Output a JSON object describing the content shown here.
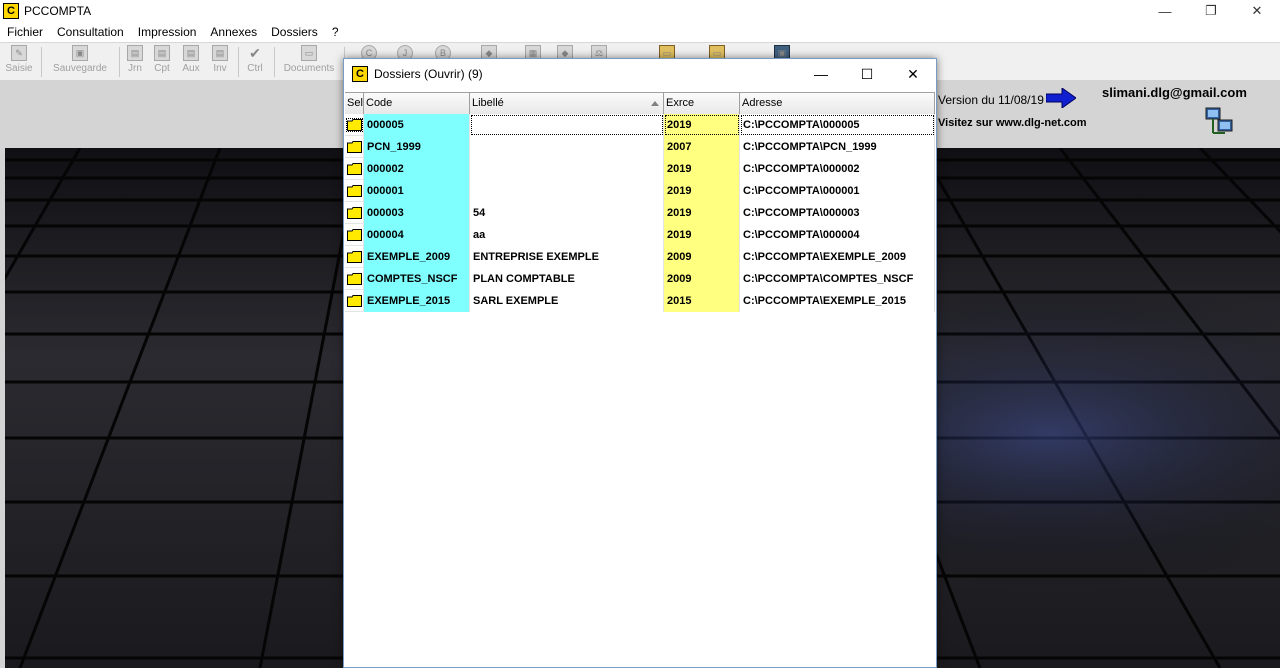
{
  "app": {
    "title": "PCCOMPTA",
    "icon_letter": "C",
    "controls": {
      "minimize": "—",
      "maximize": "❐",
      "close": "✕"
    }
  },
  "menu": [
    "Fichier",
    "Consultation",
    "Impression",
    "Annexes",
    "Dossiers",
    "?"
  ],
  "toolbar": [
    {
      "label": "Saisie",
      "icon": "pencil-icon"
    },
    {
      "label": "Sauvegarde",
      "icon": "save-icon"
    },
    {
      "label": "Jrn",
      "icon": "journal-icon"
    },
    {
      "label": "Cpt",
      "icon": "account-icon"
    },
    {
      "label": "Aux",
      "icon": "auxiliary-icon"
    },
    {
      "label": "Inv",
      "icon": "inventory-icon"
    },
    {
      "label": "Ctrl",
      "icon": "check-icon"
    },
    {
      "label": "Documents",
      "icon": "documents-icon"
    }
  ],
  "toolbar_extra_glyphs": {
    "c": "C",
    "j": "J",
    "b": "B"
  },
  "info": {
    "version": "Version du 11/08/19",
    "email": "slimani.dlg@gmail.com",
    "site": "Visitez sur  www.dlg-net.com"
  },
  "dialog": {
    "title": "Dossiers (Ouvrir)  (9)",
    "icon_letter": "C",
    "controls": {
      "minimize": "—",
      "maximize": "☐",
      "close": "✕"
    },
    "columns": {
      "sel": "Sel",
      "code": "Code",
      "libelle": "Libellé",
      "exerc": "Exrce",
      "adresse": "Adresse"
    },
    "rows": [
      {
        "code": "000005",
        "libelle": "",
        "exerc": "2019",
        "adresse": "C:\\PCCOMPTA\\000005",
        "selected": true
      },
      {
        "code": "PCN_1999",
        "libelle": "",
        "exerc": "2007",
        "adresse": "C:\\PCCOMPTA\\PCN_1999"
      },
      {
        "code": "000002",
        "libelle": "",
        "exerc": "2019",
        "adresse": "C:\\PCCOMPTA\\000002"
      },
      {
        "code": "000001",
        "libelle": "",
        "exerc": "2019",
        "adresse": "C:\\PCCOMPTA\\000001"
      },
      {
        "code": "000003",
        "libelle": "54",
        "exerc": "2019",
        "adresse": "C:\\PCCOMPTA\\000003"
      },
      {
        "code": "000004",
        "libelle": "aa",
        "exerc": "2019",
        "adresse": "C:\\PCCOMPTA\\000004"
      },
      {
        "code": "EXEMPLE_2009",
        "libelle": "ENTREPRISE EXEMPLE",
        "exerc": "2009",
        "adresse": "C:\\PCCOMPTA\\EXEMPLE_2009"
      },
      {
        "code": "COMPTES_NSCF",
        "libelle": "PLAN COMPTABLE",
        "exerc": "2009",
        "adresse": "C:\\PCCOMPTA\\COMPTES_NSCF"
      },
      {
        "code": "EXEMPLE_2015",
        "libelle": "SARL EXEMPLE",
        "exerc": "2015",
        "adresse": "C:\\PCCOMPTA\\EXEMPLE_2015"
      }
    ]
  },
  "colors": {
    "code_bg": "#80ffff",
    "exerc_bg": "#ffff80",
    "folder": "#ffea00"
  }
}
